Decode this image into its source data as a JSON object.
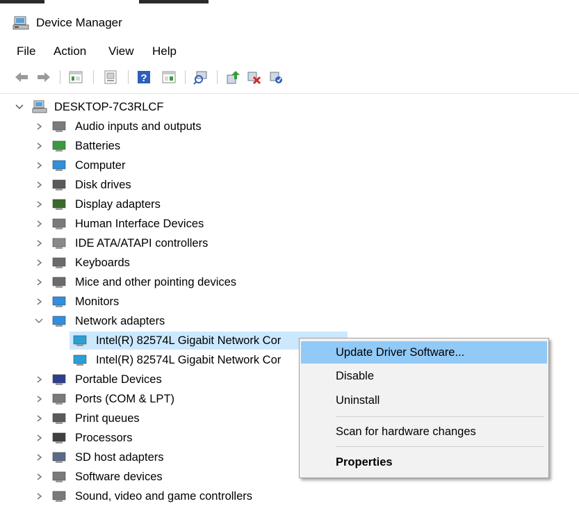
{
  "window": {
    "title": "Device Manager"
  },
  "menu": [
    "File",
    "Action",
    "View",
    "Help"
  ],
  "toolbar": {
    "icons": [
      "back-icon",
      "forward-icon",
      "properties-pane-icon",
      "show-hide-icon",
      "help-icon",
      "action-pane-icon",
      "scan-hardware-icon",
      "update-driver-icon",
      "uninstall-device-icon",
      "enable-device-icon"
    ]
  },
  "tree": {
    "root": "DESKTOP-7C3RLCF",
    "items": [
      {
        "label": "Audio inputs and outputs",
        "icon": "speaker-icon"
      },
      {
        "label": "Batteries",
        "icon": "battery-icon"
      },
      {
        "label": "Computer",
        "icon": "computer-icon"
      },
      {
        "label": "Disk drives",
        "icon": "disk-drive-icon"
      },
      {
        "label": "Display adapters",
        "icon": "display-adapter-icon"
      },
      {
        "label": "Human Interface Devices",
        "icon": "hid-icon"
      },
      {
        "label": "IDE ATA/ATAPI controllers",
        "icon": "ide-controller-icon"
      },
      {
        "label": "Keyboards",
        "icon": "keyboard-icon"
      },
      {
        "label": "Mice and other pointing devices",
        "icon": "mouse-icon"
      },
      {
        "label": "Monitors",
        "icon": "monitor-icon"
      },
      {
        "label": "Network adapters",
        "icon": "network-adapter-icon",
        "expanded": true
      },
      {
        "label": "Intel(R) 82574L Gigabit Network Cor",
        "icon": "network-card-icon",
        "child": true,
        "selected": true
      },
      {
        "label": "Intel(R) 82574L Gigabit Network Cor",
        "icon": "network-card-icon",
        "child": true
      },
      {
        "label": "Portable Devices",
        "icon": "portable-device-icon"
      },
      {
        "label": "Ports (COM & LPT)",
        "icon": "port-icon"
      },
      {
        "label": "Print queues",
        "icon": "printer-icon"
      },
      {
        "label": "Processors",
        "icon": "processor-icon"
      },
      {
        "label": "SD host adapters",
        "icon": "sd-adapter-icon"
      },
      {
        "label": "Software devices",
        "icon": "software-device-icon"
      },
      {
        "label": "Sound, video and game controllers",
        "icon": "sound-controller-icon"
      }
    ]
  },
  "context_menu": {
    "update_driver": "Update Driver Software...",
    "disable": "Disable",
    "uninstall": "Uninstall",
    "scan": "Scan for hardware changes",
    "properties": "Properties"
  },
  "colors": {
    "selection": "#cce8ff",
    "menu_highlight": "#91c9f7",
    "menu_bg": "#f2f2f2"
  }
}
